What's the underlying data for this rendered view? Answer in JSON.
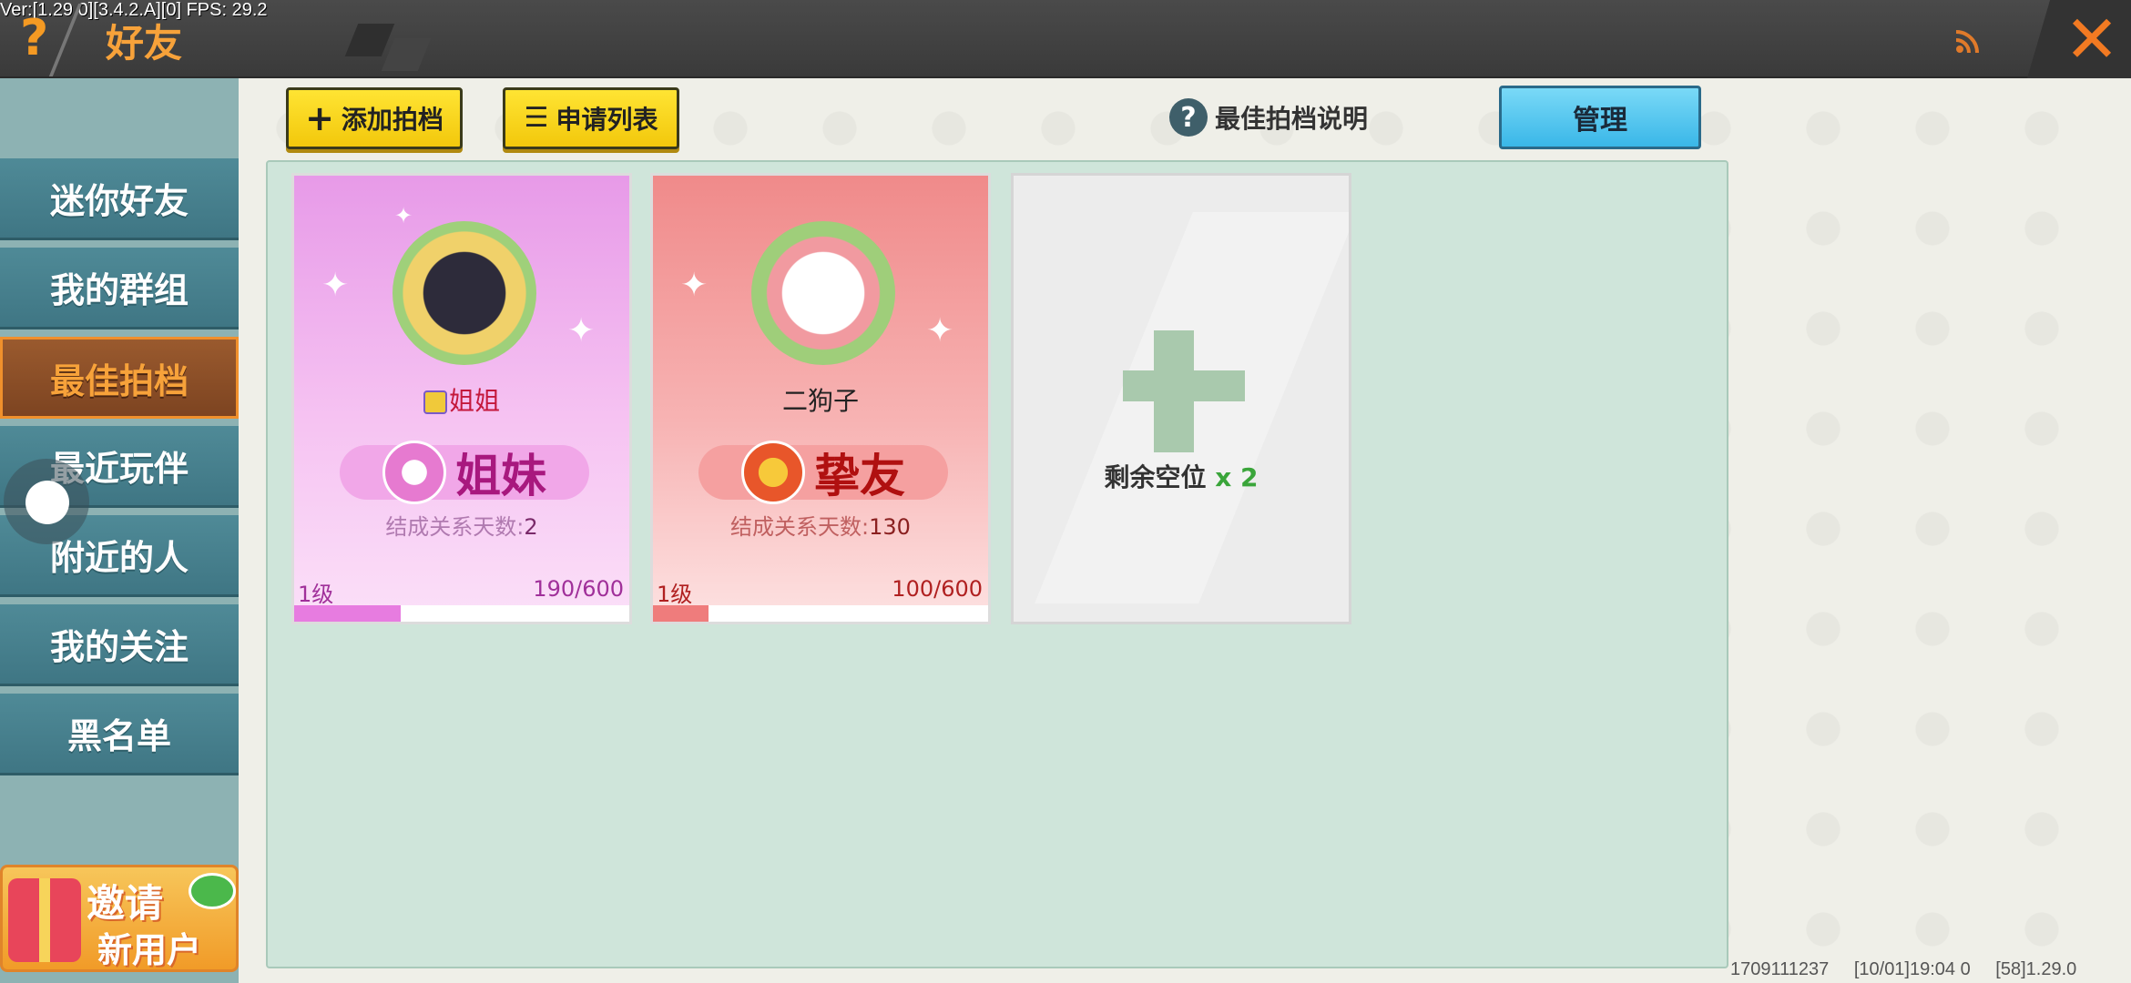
{
  "debug": {
    "version": "Ver:[1.29.0][3.4.2.A][0] FPS: 29.2"
  },
  "header": {
    "help_icon": "?",
    "title": "好友",
    "close_icon": "close-x"
  },
  "sidebar": {
    "items": [
      {
        "label": "迷你好友",
        "active": false
      },
      {
        "label": "我的群组",
        "active": false
      },
      {
        "label": "最佳拍档",
        "active": true
      },
      {
        "label": "最近玩伴",
        "active": false
      },
      {
        "label": "附近的人",
        "active": false
      },
      {
        "label": "我的关注",
        "active": false
      },
      {
        "label": "黑名单",
        "active": false
      }
    ],
    "invite": {
      "line1": "邀请",
      "line2": "新用户"
    }
  },
  "toolbar": {
    "add_label": "添加拍档",
    "apply_label": "申请列表",
    "help_label": "最佳拍档说明",
    "manage_label": "管理"
  },
  "cards": [
    {
      "name": "姐姐",
      "relation": "姐妹",
      "days_label": "结成关系天数:",
      "days": "2",
      "level": "1级",
      "exp": "190/600",
      "progress": 0.317
    },
    {
      "name": "二狗子",
      "relation": "挚友",
      "days_label": "结成关系天数:",
      "days": "130",
      "level": "1级",
      "exp": "100/600",
      "progress": 0.167
    }
  ],
  "empty_slot": {
    "label": "剩余空位",
    "count": "x 2"
  },
  "footer": {
    "id": "1709111237",
    "time": "[10/01]19:04 0",
    "build": "[58]1.29.0"
  },
  "colors": {
    "accent_orange": "#f7a23a",
    "yellow_button": "#f2c80c",
    "manage_blue": "#3ab7e8",
    "panel_green": "#cfe5da"
  }
}
